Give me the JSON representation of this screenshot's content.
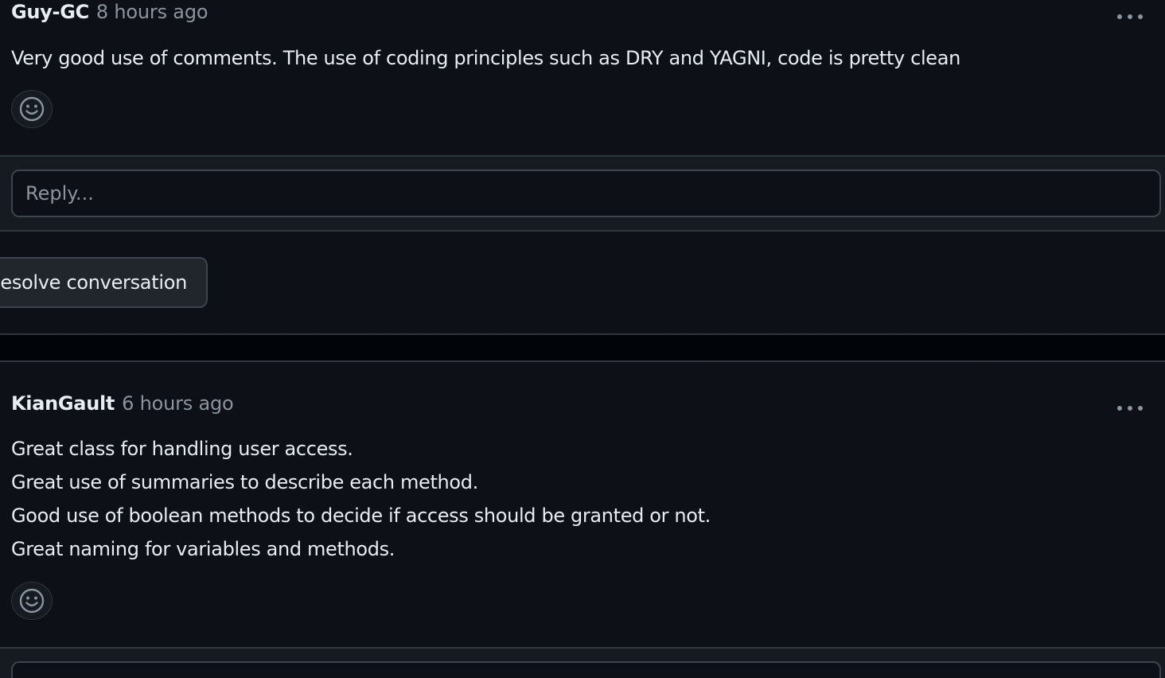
{
  "comments": [
    {
      "author": "Guy-GC",
      "timestamp": "8 hours ago",
      "body": [
        "Very good use of comments. The use of coding principles such as DRY and YAGNI, code is pretty clean"
      ],
      "menu_icon": "kebab-horizontal-icon",
      "reaction_icon": "smiley-icon"
    },
    {
      "author": "KianGault",
      "timestamp": "6 hours ago",
      "body": [
        "Great class for handling user access.",
        "Great use of summaries to describe each method.",
        "Good use of boolean methods to decide if access should be granted or not.",
        "Great naming for variables and methods."
      ],
      "menu_icon": "kebab-horizontal-icon",
      "reaction_icon": "smiley-icon"
    }
  ],
  "reply": {
    "placeholder": "Reply..."
  },
  "resolve": {
    "label": "esolve conversation"
  },
  "colors": {
    "background": "#0d1117",
    "band": "#161b22",
    "border": "#30363d",
    "text": "#e6edf3",
    "muted": "#8b949e"
  }
}
